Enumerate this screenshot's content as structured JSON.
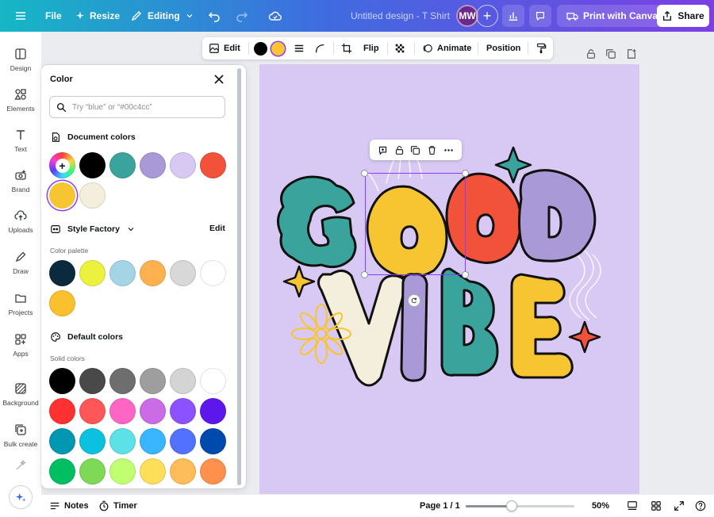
{
  "topbar": {
    "file": "File",
    "resize": "Resize",
    "editing": "Editing",
    "design_title": "Untitled design - T Shirt",
    "avatar_initials": "MW",
    "add_icon": "+",
    "print": "Print with Canva",
    "share": "Share"
  },
  "rail": [
    {
      "label": "Design",
      "icon": "design-icon"
    },
    {
      "label": "Elements",
      "icon": "elements-icon"
    },
    {
      "label": "Text",
      "icon": "text-icon"
    },
    {
      "label": "Brand",
      "icon": "brand-icon"
    },
    {
      "label": "Uploads",
      "icon": "uploads-icon"
    },
    {
      "label": "Draw",
      "icon": "draw-icon"
    },
    {
      "label": "Projects",
      "icon": "projects-icon"
    },
    {
      "label": "Apps",
      "icon": "apps-icon"
    },
    {
      "label": "Background",
      "icon": "background-icon"
    },
    {
      "label": "Bulk create",
      "icon": "bulk-create-icon"
    }
  ],
  "panel": {
    "title": "Color",
    "search_placeholder": "Try “blue” or “#00c4cc”",
    "document_colors_title": "Document colors",
    "document_colors": [
      "#000000",
      "#3aa39c",
      "#a999d6",
      "#d7c9f3",
      "#f2513a",
      "#f7c531",
      "#f4efdd"
    ],
    "add_color_symbol": "+",
    "style_title": "Style Factory",
    "style_edit": "Edit",
    "palette_label": "Color palette",
    "palette": [
      "#0c2a3d",
      "#ecf13e",
      "#a4d4e6",
      "#ffb14f",
      "#d8d8d8",
      "#ffffff",
      "#fbc02d"
    ],
    "default_title": "Default colors",
    "solid_label": "Solid colors",
    "solid": [
      "#000000",
      "#494949",
      "#6e6e6e",
      "#9e9e9e",
      "#d4d4d4",
      "#ffffff",
      "#ff3131",
      "#ff5757",
      "#ff66c4",
      "#cb6ce6",
      "#8c52ff",
      "#5e17eb",
      "#0097b2",
      "#0cc0df",
      "#5ce1e6",
      "#38b6ff",
      "#5271ff",
      "#004aad",
      "#00bf63",
      "#7ed957",
      "#c1ff72",
      "#ffde59",
      "#ffbd59",
      "#ff914d"
    ]
  },
  "context_toolbar": {
    "edit": "Edit",
    "color1": "#000000",
    "color2": "#fbc531",
    "flip": "Flip",
    "animate": "Animate",
    "position": "Position"
  },
  "canvas": {
    "background": "#d7c9f3",
    "word1": "GOOD",
    "word2": "VIBE"
  },
  "bottombar": {
    "notes": "Notes",
    "timer": "Timer",
    "page": "Page 1 / 1",
    "zoom": "50%",
    "zoom_level": 0.42
  }
}
